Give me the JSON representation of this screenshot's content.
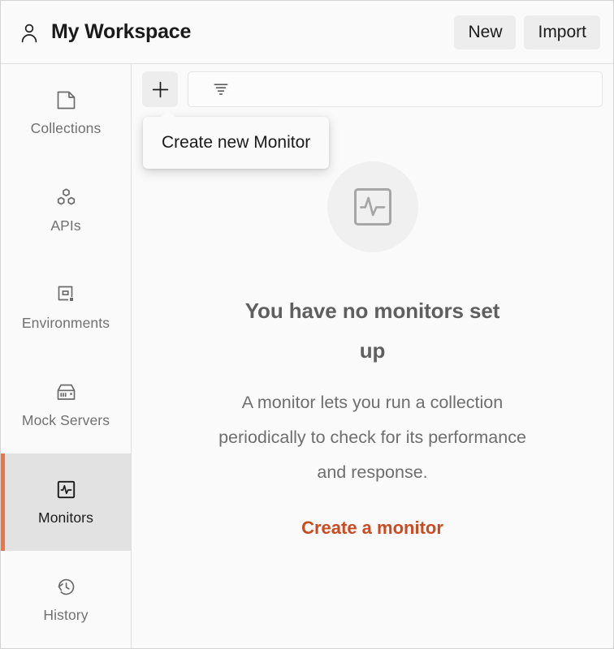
{
  "header": {
    "workspace_title": "My Workspace",
    "user_icon": "user-icon",
    "buttons": [
      {
        "label": "New",
        "name": "new-button"
      },
      {
        "label": "Import",
        "name": "import-button"
      }
    ]
  },
  "sidebar": {
    "items": [
      {
        "label": "Collections",
        "icon": "collections-icon",
        "active": false
      },
      {
        "label": "APIs",
        "icon": "apis-icon",
        "active": false
      },
      {
        "label": "Environments",
        "icon": "environments-icon",
        "active": false
      },
      {
        "label": "Mock Servers",
        "icon": "mock-servers-icon",
        "active": false
      },
      {
        "label": "Monitors",
        "icon": "monitors-icon",
        "active": true
      },
      {
        "label": "History",
        "icon": "history-icon",
        "active": false
      }
    ],
    "active_indicator_color": "#ef7444",
    "active_background_color": "#e2e2e2"
  },
  "toolbar": {
    "create_icon": "plus-icon",
    "filter_icon": "filter-icon",
    "filter_placeholder": ""
  },
  "tooltip": {
    "text": "Create new Monitor"
  },
  "empty_state": {
    "icon": "monitor-pulse-icon",
    "title": "You have no monitors set up",
    "description": "A monitor lets you run a collection periodically to check for its performance and response.",
    "cta_label": "Create a monitor",
    "cta_color": "#cc4a1f"
  }
}
